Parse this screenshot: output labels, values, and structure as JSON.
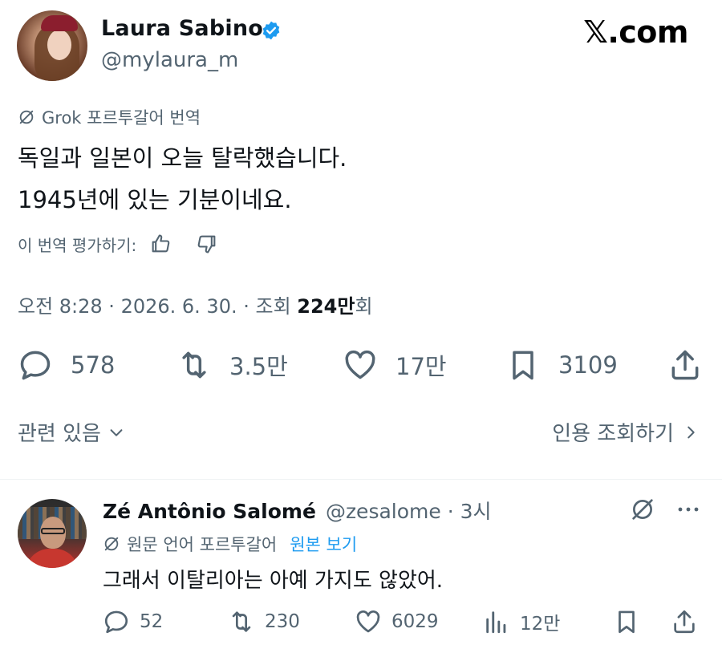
{
  "author": {
    "name": "Laura Sabino",
    "handle": "@mylaura_m",
    "verified": true
  },
  "site_label": "𝕏.com",
  "translation": {
    "source_note": "Grok 포르투갈어 번역",
    "text_line1": "독일과 일본이 오늘 탈락했습니다.",
    "text_line2": "1945년에 있는 기분이네요.",
    "rate_label": "이 번역 평가하기:"
  },
  "meta": {
    "time_date": "오전 8:28 · 2026. 6. 30. · 조회 ",
    "views_count": "224만",
    "views_suffix": "회"
  },
  "stats": {
    "replies": "578",
    "retweets": "3.5만",
    "likes": "17만",
    "bookmarks": "3109"
  },
  "related_label": "관련 있음",
  "quotes_label": "인용 조회하기",
  "reply": {
    "name": "Zé Antônio Salomé",
    "handle": "@zesalome · 3시",
    "trans_note": "원문 언어 포르투갈어",
    "view_original": "원본 보기",
    "text": "그래서 이탈리아는 아예 가지도 않았어.",
    "replies": "52",
    "retweets": "230",
    "likes": "6029",
    "views": "12만"
  },
  "colors": {
    "accent": "#1d9bf0",
    "muted": "#536471",
    "text": "#0f1419"
  }
}
